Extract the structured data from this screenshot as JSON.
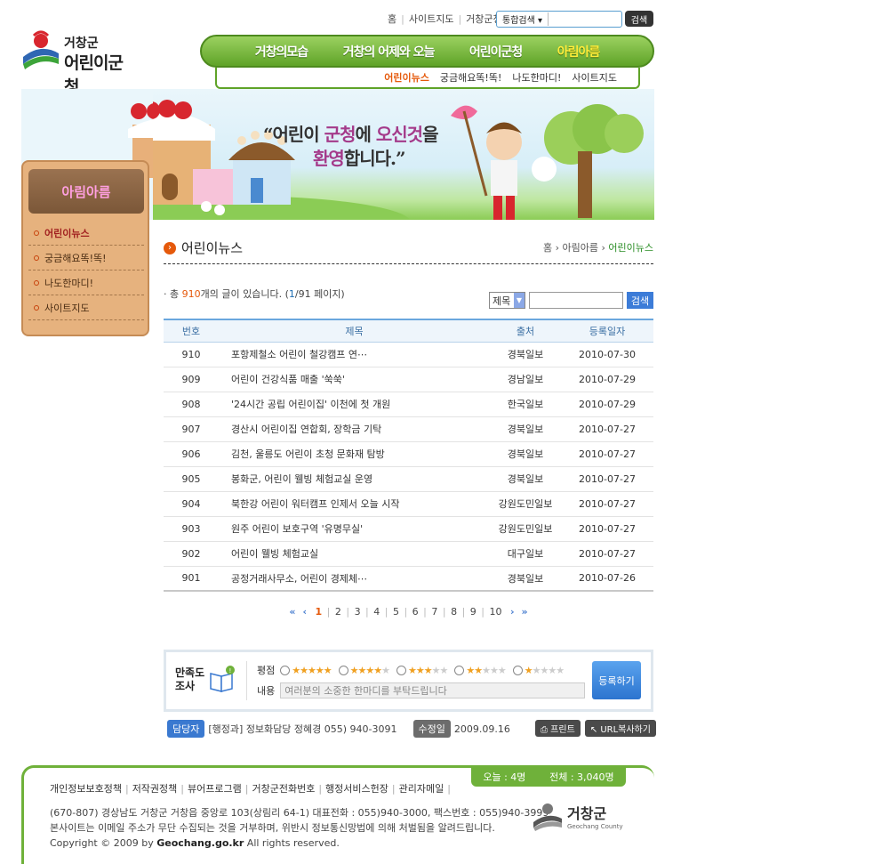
{
  "util": {
    "links": [
      "홈",
      "사이트지도",
      "거창군청"
    ]
  },
  "top_search": {
    "select": "통합검색 ▾",
    "button": "검색"
  },
  "logo": {
    "line1": "거창군",
    "line2": "어린이군청"
  },
  "gnb": [
    {
      "label": "거창의모습"
    },
    {
      "label": "거창의 어제와 오늘"
    },
    {
      "label": "어린이군청"
    },
    {
      "label": "아림아름"
    }
  ],
  "subnav": [
    {
      "label": "어린이뉴스"
    },
    {
      "label": "궁금해요똑!똑!"
    },
    {
      "label": "나도한마디!"
    },
    {
      "label": "사이트지도"
    }
  ],
  "banner": {
    "line1a": "“어린이 ",
    "line1b": "군청",
    "line1c": "에 ",
    "line1d": "오신것",
    "line1e": "을",
    "line2a": "환영",
    "line2b": "합니다.”"
  },
  "lnb": {
    "title": "아림아름",
    "items": [
      "어린이뉴스",
      "궁금해요똑!똑!",
      "나도한마디!",
      "사이트지도"
    ]
  },
  "content": {
    "title": "어린이뉴스",
    "crumb": [
      "홈",
      "아림아름",
      "어린이뉴스"
    ],
    "count_prefix": "· 총 ",
    "count_total": "910",
    "count_mid": "개의 글이 있습니다. (",
    "count_page": "1",
    "count_suffix": "/91 페이지)",
    "search_select": "제목",
    "search_button": "검색"
  },
  "table": {
    "headers": [
      "번호",
      "제목",
      "출처",
      "등록일자"
    ],
    "rows": [
      {
        "no": "910",
        "title": "포항제철소 어린이 철강캠프 연⋯",
        "src": "경북일보",
        "date": "2010-07-30"
      },
      {
        "no": "909",
        "title": "어린이 건강식품 매출 '쑥쑥'",
        "src": "경남일보",
        "date": "2010-07-29"
      },
      {
        "no": "908",
        "title": "'24시간 공립 어린이집' 이천에 첫 개원",
        "src": "한국일보",
        "date": "2010-07-29"
      },
      {
        "no": "907",
        "title": "경산시 어린이집 연합회, 장학금 기탁",
        "src": "경북일보",
        "date": "2010-07-27"
      },
      {
        "no": "906",
        "title": "김천, 울릉도 어린이 초청 문화재 탐방",
        "src": "경북일보",
        "date": "2010-07-27"
      },
      {
        "no": "905",
        "title": "봉화군, 어린이 웰빙 체험교실 운영",
        "src": "경북일보",
        "date": "2010-07-27"
      },
      {
        "no": "904",
        "title": "북한강 어린이 워터캠프 인제서 오늘 시작",
        "src": "강원도민일보",
        "date": "2010-07-27"
      },
      {
        "no": "903",
        "title": "원주 어린이 보호구역 '유명무실'",
        "src": "강원도민일보",
        "date": "2010-07-27"
      },
      {
        "no": "902",
        "title": "어린이 웰빙 체험교실",
        "src": "대구일보",
        "date": "2010-07-27"
      },
      {
        "no": "901",
        "title": "공정거래사무소, 어린이 경제체⋯",
        "src": "경북일보",
        "date": "2010-07-26"
      }
    ]
  },
  "paging": {
    "first": "«",
    "prev": "‹",
    "next": "›",
    "last": "»",
    "pages": [
      "1",
      "2",
      "3",
      "4",
      "5",
      "6",
      "7",
      "8",
      "9",
      "10"
    ]
  },
  "survey": {
    "label1": "만족도",
    "label2": "조사",
    "rating_label": "평점",
    "content_label": "내용",
    "content_placeholder": "여러분의 소중한 한마디를 부탁드립니다",
    "submit": "등록하기",
    "options": [
      5,
      4,
      3,
      2,
      1
    ]
  },
  "manager": {
    "tag": "담당자",
    "info": "[행정과] 정보화담당 정혜경  055) 940-3091",
    "mod_tag": "수정일",
    "mod_date": "2009.09.16"
  },
  "tools": {
    "print": "⎙ 프린트",
    "url": "↖ URL복사하기"
  },
  "footer": {
    "visitor_today": "오늘 : 4명",
    "visitor_total": "전체 : 3,040명",
    "links": [
      "개인정보보호정책",
      "저작권정책",
      "뷰어프로그램",
      "거창군전화번호",
      "행정서비스헌장",
      "관리자메일"
    ],
    "addr1": "(670-807) 경상남도 거창군 거창읍 중앙로 103(상림리 64-1)   대표전화 : 055)940-3000, 팩스번호 : 055)940-3999",
    "addr2": "본사이트는 이메일 주소가 무단 수집되는 것을 거부하며, 위반시 정보통신망법에 의해 처벌됨을 알려드립니다.",
    "copy_a": "Copyright © 2009 by ",
    "copy_b": "Geochang.go.kr",
    "copy_c": " All rights reserved.",
    "logo_text": "거창군",
    "logo_sub": "Geochang County"
  }
}
